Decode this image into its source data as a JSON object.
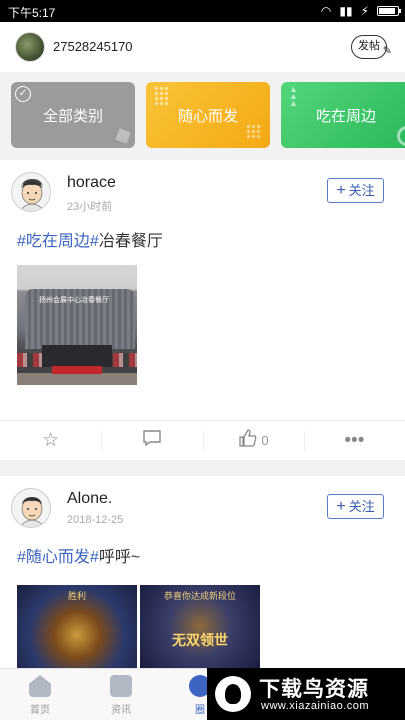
{
  "status_bar": {
    "time": "下午5:17",
    "signal": "▮▮",
    "charge": "⚡"
  },
  "header": {
    "username": "27528245170",
    "post_label": "发帖"
  },
  "categories": [
    {
      "label": "全部类别",
      "selected": true,
      "color": "#9b9b9b"
    },
    {
      "label": "随心而发",
      "selected": false,
      "color": "#f5b324"
    },
    {
      "label": "吃在周边",
      "selected": false,
      "color": "#39c466"
    }
  ],
  "posts": [
    {
      "author": "horace",
      "time": "23小时前",
      "follow_label": "关注",
      "tag1": "#吃在周边",
      "tag2": "#",
      "text": "冶春餐厅",
      "photo_sign": "扬州会展中心冶春餐厅",
      "likes": "0"
    },
    {
      "author": "Alone.",
      "time": "2018-12-25",
      "follow_label": "关注",
      "tag1": "#随心而发",
      "tag2": "#",
      "text": "呼呼~",
      "photo1_caption": "胜利",
      "photo2_top": "恭喜你达成新段位",
      "photo2_caption": "无双领世"
    }
  ],
  "tabbar": {
    "home": "首页",
    "news": "资讯",
    "circle": "圈"
  },
  "watermark": {
    "title": "下载鸟资源",
    "url": "www.xiazainiao.com"
  },
  "colors": {
    "accent": "#3c64c0",
    "tag": "#3c64c0"
  }
}
